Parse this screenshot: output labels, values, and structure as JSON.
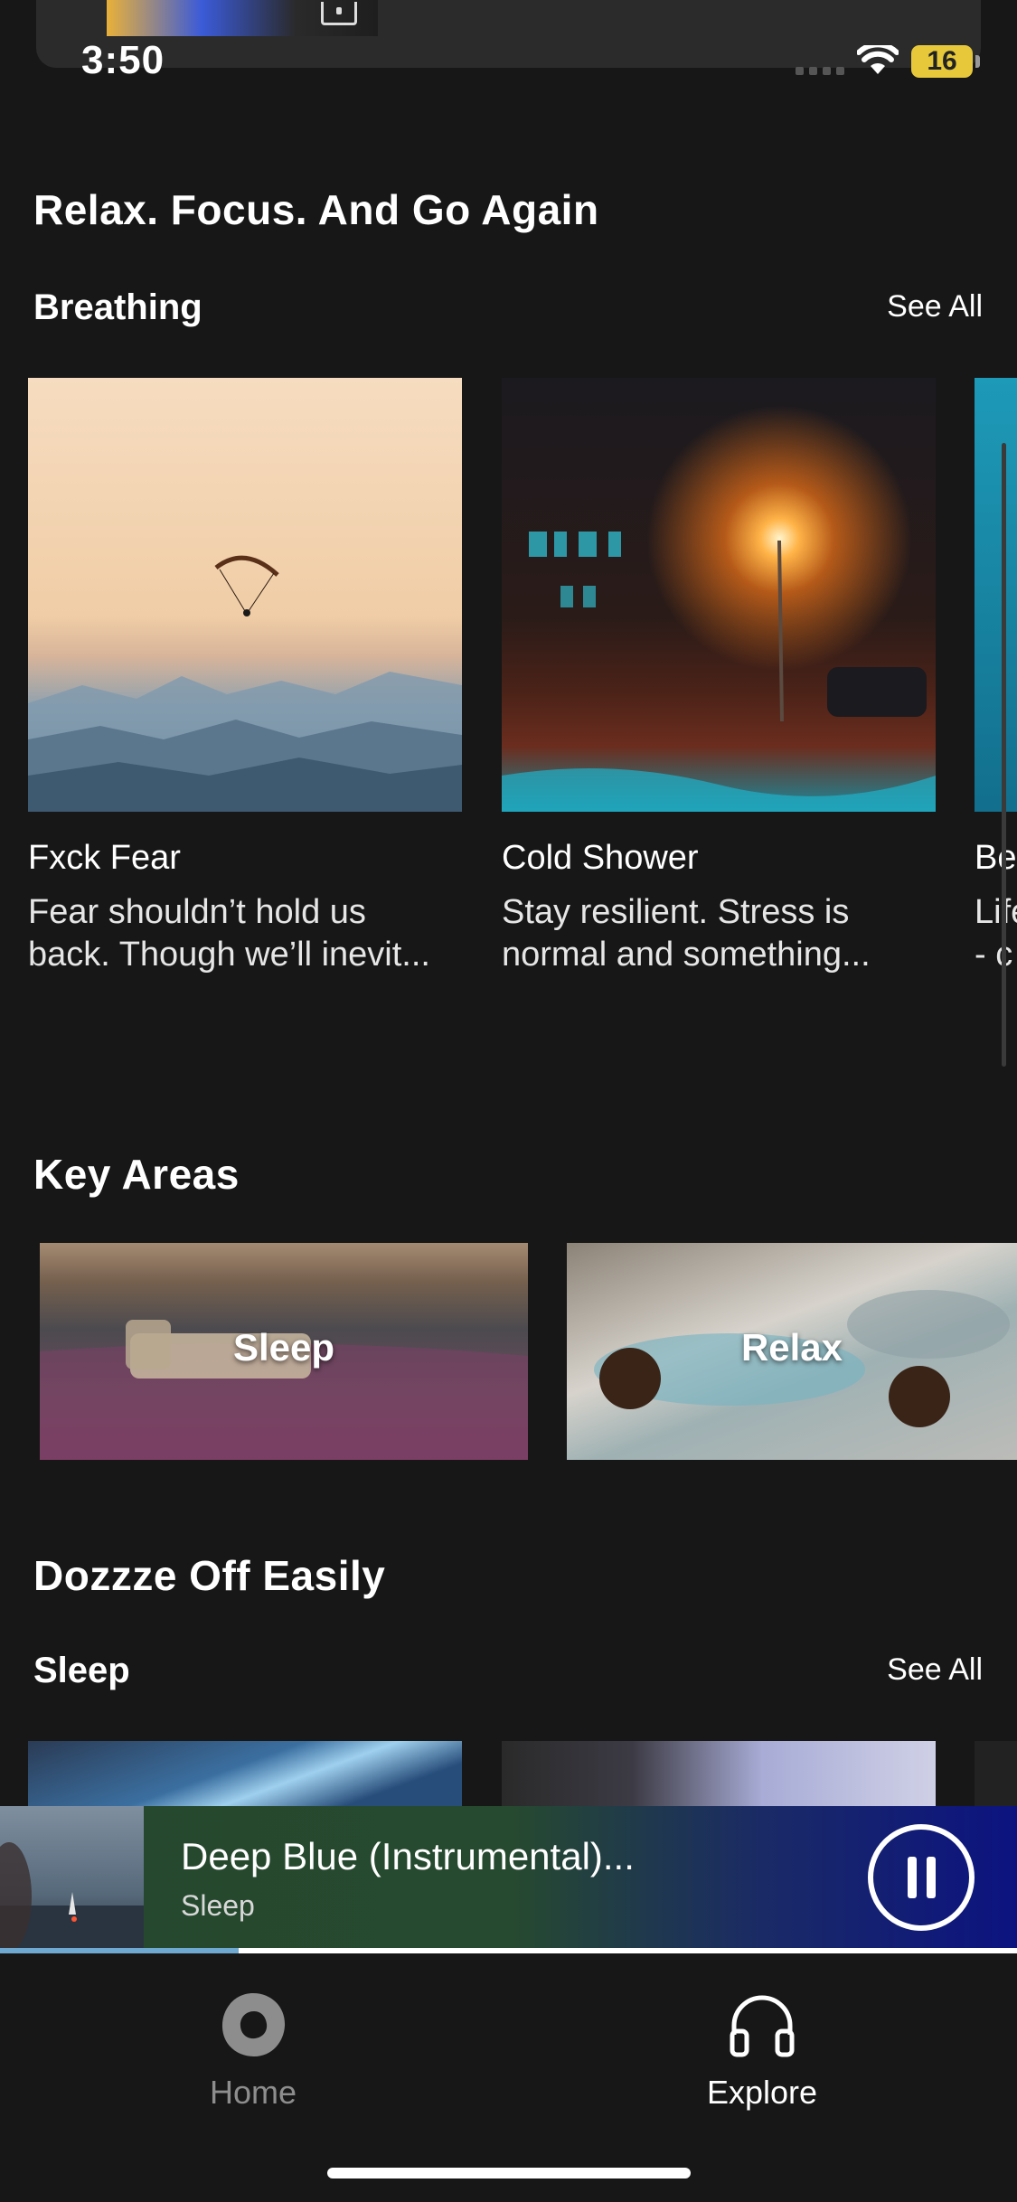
{
  "status_bar": {
    "time": "3:50",
    "battery": "16"
  },
  "colors": {
    "background": "#171717",
    "accent_progress": "#6fa8d0",
    "text": "#ffffff"
  },
  "sections": {
    "relax": {
      "title": "Relax. Focus. And Go Again"
    },
    "breathing": {
      "title": "Breathing",
      "see_all": "See All",
      "cards": [
        {
          "title": "Fxck Fear",
          "desc_line1": "Fear shouldn’t hold us",
          "desc_line2": "back. Though we’ll inevit..."
        },
        {
          "title": "Cold Shower",
          "desc_line1": "Stay resilient. Stress is",
          "desc_line2": "normal and something..."
        },
        {
          "title": "Be",
          "desc_line1": "Life",
          "desc_line2": "- c"
        }
      ]
    },
    "key_areas": {
      "title": "Key Areas",
      "tiles": [
        {
          "label": "Sleep"
        },
        {
          "label": "Relax"
        }
      ]
    },
    "doze": {
      "title": "Dozzze Off Easily"
    },
    "sleep": {
      "title": "Sleep",
      "see_all": "See All"
    }
  },
  "mini_player": {
    "title": "Deep Blue (Instrumental)...",
    "subtitle": "Sleep",
    "progress": 0.235
  },
  "tab_bar": {
    "tabs": [
      {
        "label": "Home",
        "icon": "home-blob-icon",
        "active": false
      },
      {
        "label": "Explore",
        "icon": "headphones-icon",
        "active": true
      }
    ]
  }
}
